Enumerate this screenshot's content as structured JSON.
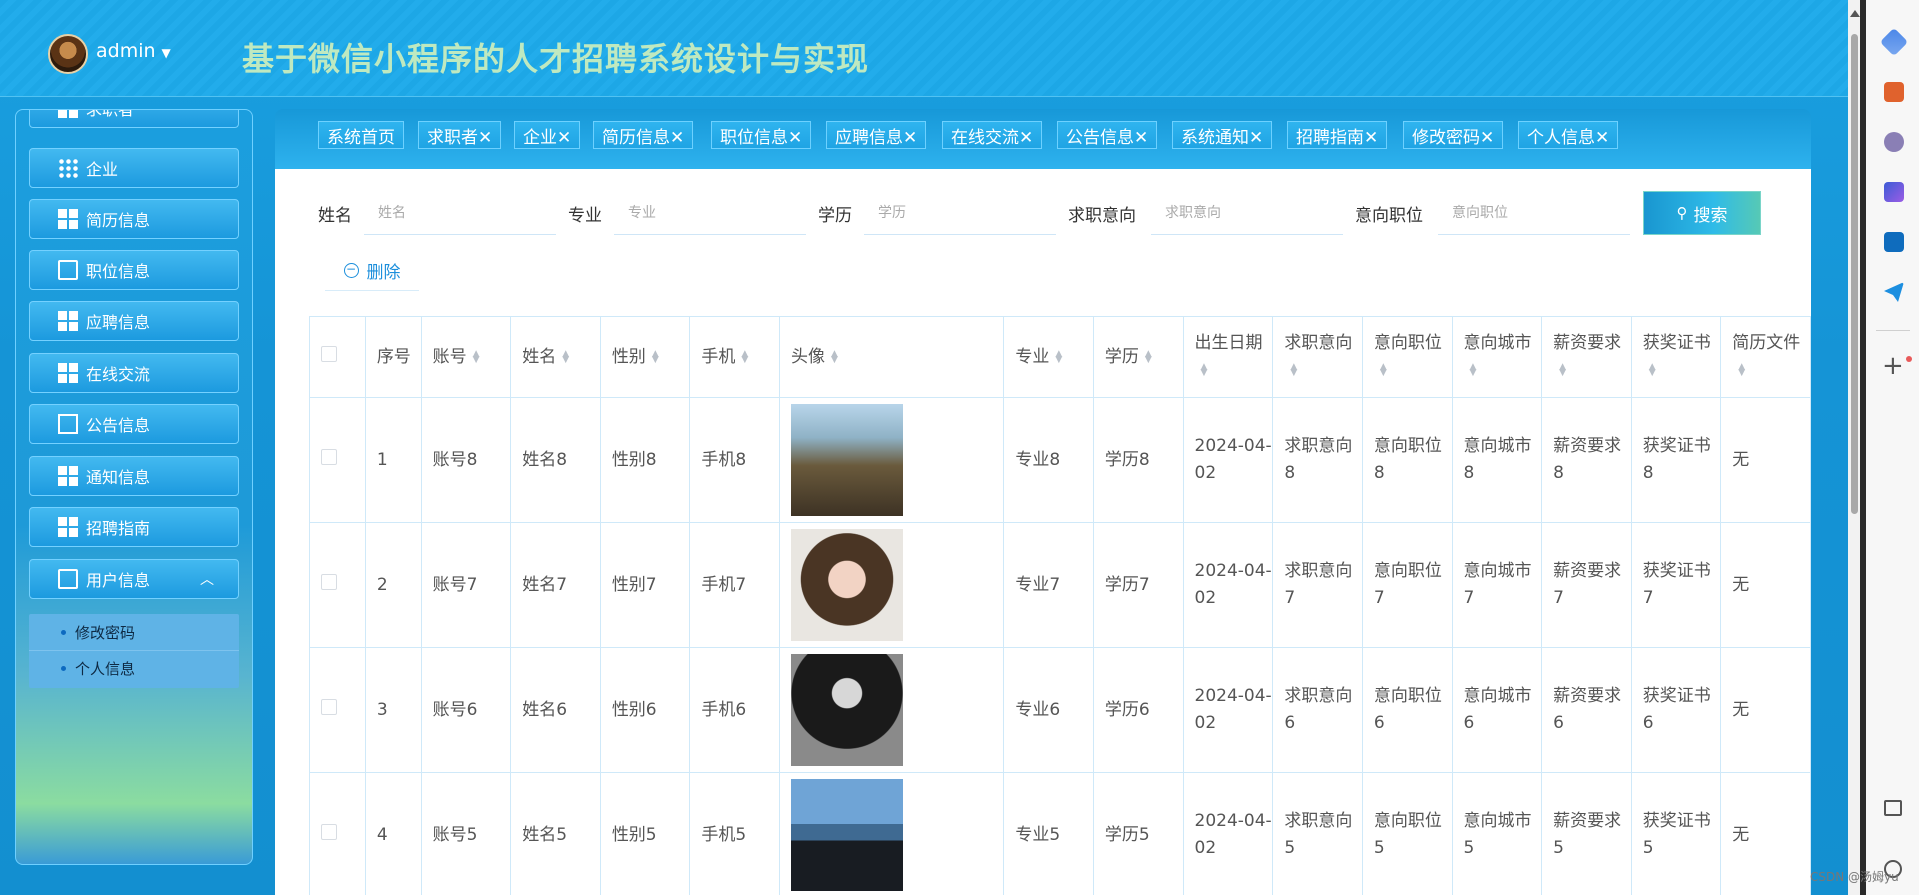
{
  "header": {
    "username": "admin",
    "title": "基于微信小程序的人才招聘系统设计与实现"
  },
  "sidebar": {
    "partial_item": "求职者",
    "items": [
      {
        "label": "企业",
        "icon": "grid-icon"
      },
      {
        "label": "简历信息",
        "icon": "grid-icon"
      },
      {
        "label": "职位信息",
        "icon": "clipboard-icon"
      },
      {
        "label": "应聘信息",
        "icon": "grid-icon"
      },
      {
        "label": "在线交流",
        "icon": "grid-icon"
      },
      {
        "label": "公告信息",
        "icon": "chart-icon"
      },
      {
        "label": "通知信息",
        "icon": "grid-icon"
      },
      {
        "label": "招聘指南",
        "icon": "grid-icon"
      },
      {
        "label": "用户信息",
        "icon": "card-icon"
      }
    ],
    "sub_items": [
      {
        "label": "修改密码"
      },
      {
        "label": "个人信息"
      }
    ]
  },
  "tabs": [
    {
      "label": "系统首页"
    },
    {
      "label": "求职者✕"
    },
    {
      "label": "企业✕"
    },
    {
      "label": "简历信息✕"
    },
    {
      "label": "职位信息✕"
    },
    {
      "label": "应聘信息✕"
    },
    {
      "label": "在线交流✕"
    },
    {
      "label": "公告信息✕"
    },
    {
      "label": "系统通知✕"
    },
    {
      "label": "招聘指南✕"
    },
    {
      "label": "修改密码✕"
    },
    {
      "label": "个人信息✕"
    }
  ],
  "filters": [
    {
      "label": "姓名",
      "placeholder": "姓名"
    },
    {
      "label": "专业",
      "placeholder": "专业"
    },
    {
      "label": "学历",
      "placeholder": "学历"
    },
    {
      "label": "求职意向",
      "placeholder": "求职意向"
    },
    {
      "label": "意向职位",
      "placeholder": "意向职位"
    }
  ],
  "buttons": {
    "search": "搜索",
    "delete": "删除"
  },
  "table": {
    "headers": [
      "序号",
      "账号",
      "姓名",
      "性别",
      "手机",
      "头像",
      "专业",
      "学历",
      "出生日期",
      "求职意向",
      "意向职位",
      "意向城市",
      "薪资要求",
      "获奖证书",
      "简历文件"
    ],
    "rows": [
      {
        "no": "1",
        "account": "账号8",
        "name": "姓名8",
        "gender": "性别8",
        "phone": "手机8",
        "major": "专业8",
        "edu": "学历8",
        "birth": "2024-04-02",
        "intent": "求职意向8",
        "position": "意向职位8",
        "city": "意向城市8",
        "salary": "薪资要求8",
        "cert": "获奖证书8",
        "file": "无"
      },
      {
        "no": "2",
        "account": "账号7",
        "name": "姓名7",
        "gender": "性别7",
        "phone": "手机7",
        "major": "专业7",
        "edu": "学历7",
        "birth": "2024-04-02",
        "intent": "求职意向7",
        "position": "意向职位7",
        "city": "意向城市7",
        "salary": "薪资要求7",
        "cert": "获奖证书7",
        "file": "无"
      },
      {
        "no": "3",
        "account": "账号6",
        "name": "姓名6",
        "gender": "性别6",
        "phone": "手机6",
        "major": "专业6",
        "edu": "学历6",
        "birth": "2024-04-02",
        "intent": "求职意向6",
        "position": "意向职位6",
        "city": "意向城市6",
        "salary": "薪资要求6",
        "cert": "获奖证书6",
        "file": "无"
      },
      {
        "no": "4",
        "account": "账号5",
        "name": "姓名5",
        "gender": "性别5",
        "phone": "手机5",
        "major": "专业5",
        "edu": "学历5",
        "birth": "2024-04-02",
        "intent": "求职意向5",
        "position": "意向职位5",
        "city": "意向城市5",
        "salary": "薪资要求5",
        "cert": "获奖证书5",
        "file": "无"
      }
    ]
  },
  "watermark": "CSDN @汤姆yu"
}
